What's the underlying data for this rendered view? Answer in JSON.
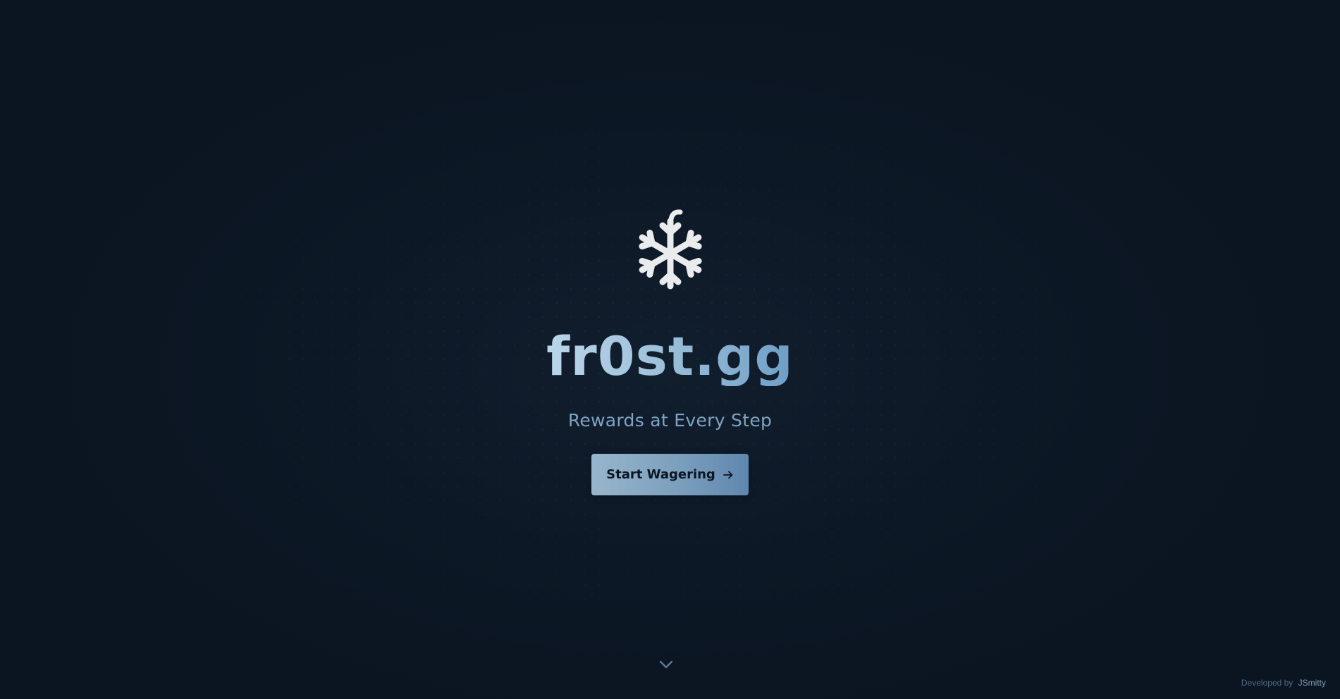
{
  "brand": {
    "name": "fr0st.gg",
    "tagline": "Rewards at Every Step",
    "logo_icon": "snowflake-icon"
  },
  "cta": {
    "label": "Start Wagering",
    "icon": "arrow-right-icon"
  },
  "scroll_indicator": {
    "icon": "chevron-down-icon"
  },
  "footer": {
    "credit_prefix": "Developed by",
    "credit_author": "JSmitty"
  },
  "colors": {
    "background": "#0c1623",
    "title_gradient_start": "#b9d6ea",
    "title_gradient_end": "#6e9ec6",
    "tagline": "#7fa3c2",
    "button_gradient_start": "#98b6cb",
    "button_gradient_end": "#5f87ae",
    "button_text": "#0c1623",
    "logo": "#e9ebed"
  }
}
